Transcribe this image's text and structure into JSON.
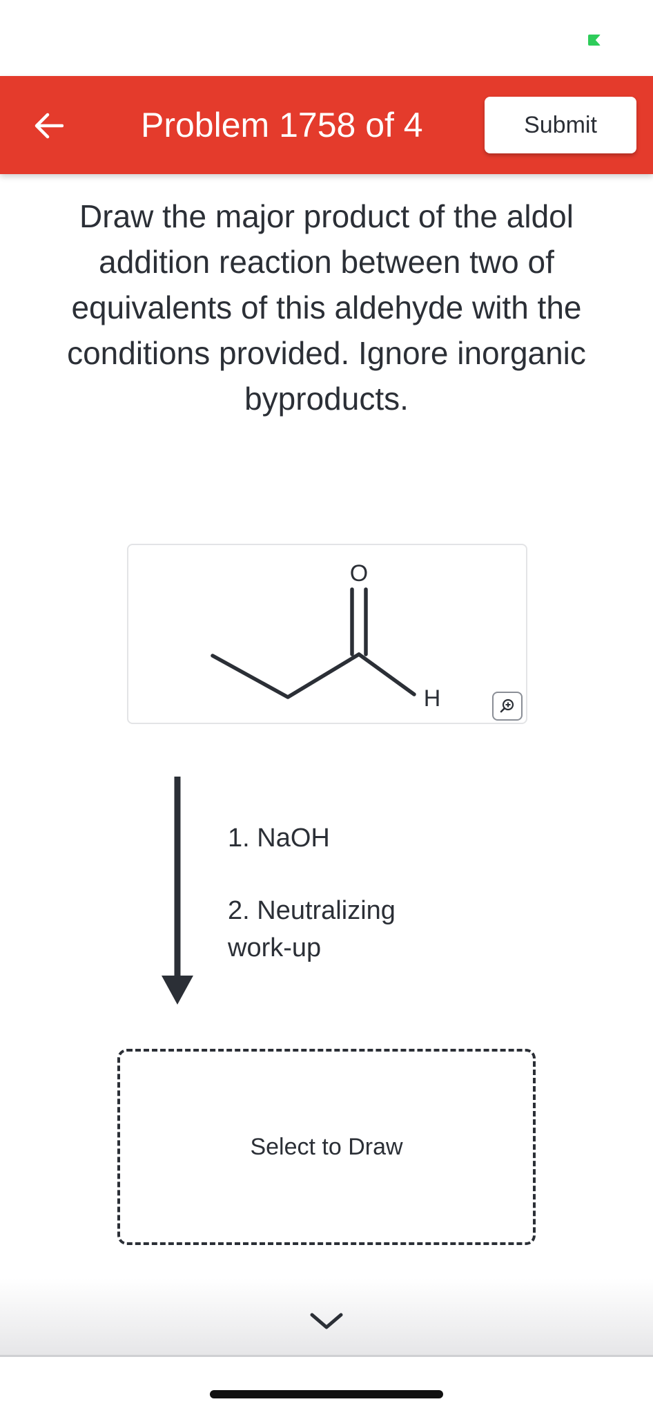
{
  "header": {
    "title": "Problem 1758 of 4",
    "submit_label": "Submit"
  },
  "question": {
    "text": "Draw the major product of the aldol addition reaction between two of equivalents of this aldehyde with the conditions provided. Ignore inorganic byproducts."
  },
  "reactant": {
    "oxygen_label": "O",
    "hydrogen_label": "H"
  },
  "conditions": {
    "step1": "1. NaOH",
    "step2_line1": "2. Neutralizing",
    "step2_line2": "work-up"
  },
  "answer_box": {
    "label": "Select to Draw"
  },
  "colors": {
    "header_red": "#e43b2c",
    "text_dark": "#2b2f36",
    "status_green": "#2ecc5a"
  },
  "icons": {
    "back": "arrow-left-icon",
    "zoom": "zoom-in-icon",
    "next": "chevron-down-icon"
  }
}
